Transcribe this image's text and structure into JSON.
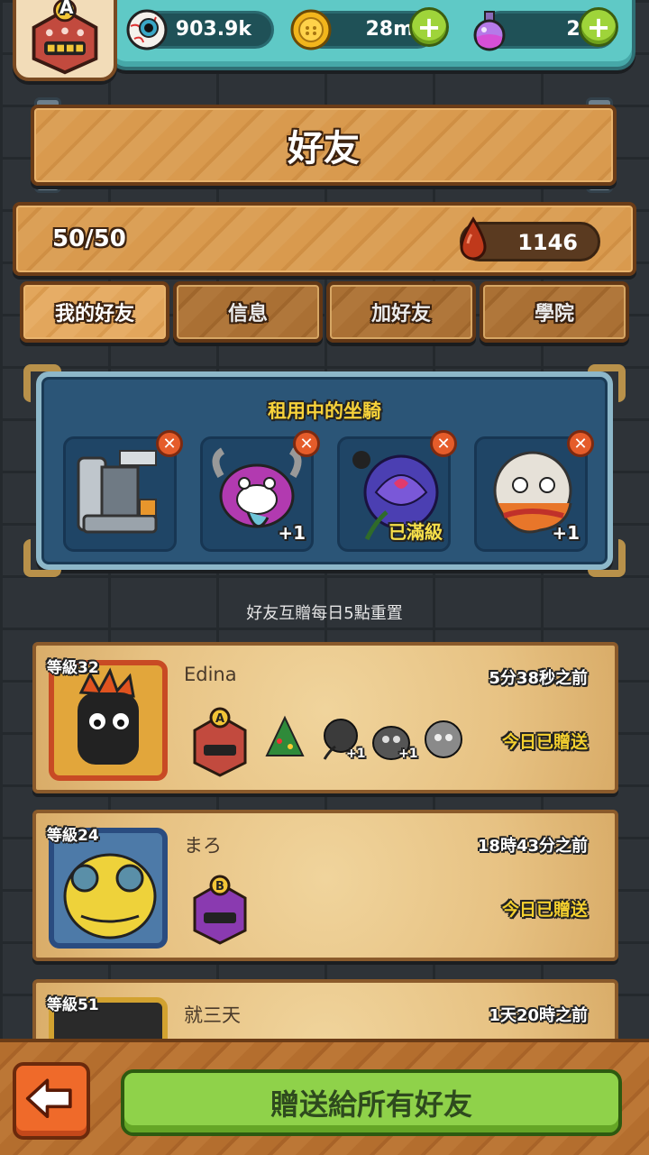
{
  "resources": {
    "eyeballs": {
      "value": "903.9k",
      "icon": "eyeball-icon"
    },
    "coins": {
      "value": "28m",
      "icon": "coin-icon"
    },
    "potions": {
      "value": "20",
      "icon": "potion-icon"
    }
  },
  "player": {
    "rank_letter": "A"
  },
  "header": {
    "title": "好友"
  },
  "friends_summary": {
    "count": "50/50",
    "gem_value": "1146"
  },
  "tabs": [
    {
      "label": "我的好友",
      "active": true
    },
    {
      "label": "信息",
      "active": false
    },
    {
      "label": "加好友",
      "active": false
    },
    {
      "label": "學院",
      "active": false
    }
  ],
  "rental": {
    "title": "租用中的坐騎",
    "mounts": [
      {
        "icon": "machine-mount-icon",
        "tag": ""
      },
      {
        "icon": "purple-monster-mount-icon",
        "tag": "+1"
      },
      {
        "icon": "rose-mount-icon",
        "tag": "已滿級"
      },
      {
        "icon": "lion-dance-mount-icon",
        "tag": "+1"
      }
    ]
  },
  "reset_note": "好友互贈每日5點重置",
  "friends": [
    {
      "level": "等級32",
      "name": "Edina",
      "time": "5分38秒之前",
      "sent": "今日已贈送",
      "rank": "A",
      "mount_tags": [
        "",
        "+1",
        "+1",
        ""
      ]
    },
    {
      "level": "等級24",
      "name": "まろ",
      "time": "18時43分之前",
      "sent": "今日已贈送",
      "rank": "B",
      "mount_tags": []
    },
    {
      "level": "等級51",
      "name": "就三天",
      "time": "1天20時之前",
      "sent": "",
      "rank": "",
      "mount_tags": []
    }
  ],
  "bottom": {
    "gift_all_label": "贈送給所有好友"
  },
  "colors": {
    "teal_bar": "#5fc9c6",
    "wood": "#d99a4e",
    "panel_blue": "#2b5577",
    "button_green": "#8fd24a",
    "back_orange": "#ef6a2a",
    "gold_text": "#f4d02f"
  }
}
